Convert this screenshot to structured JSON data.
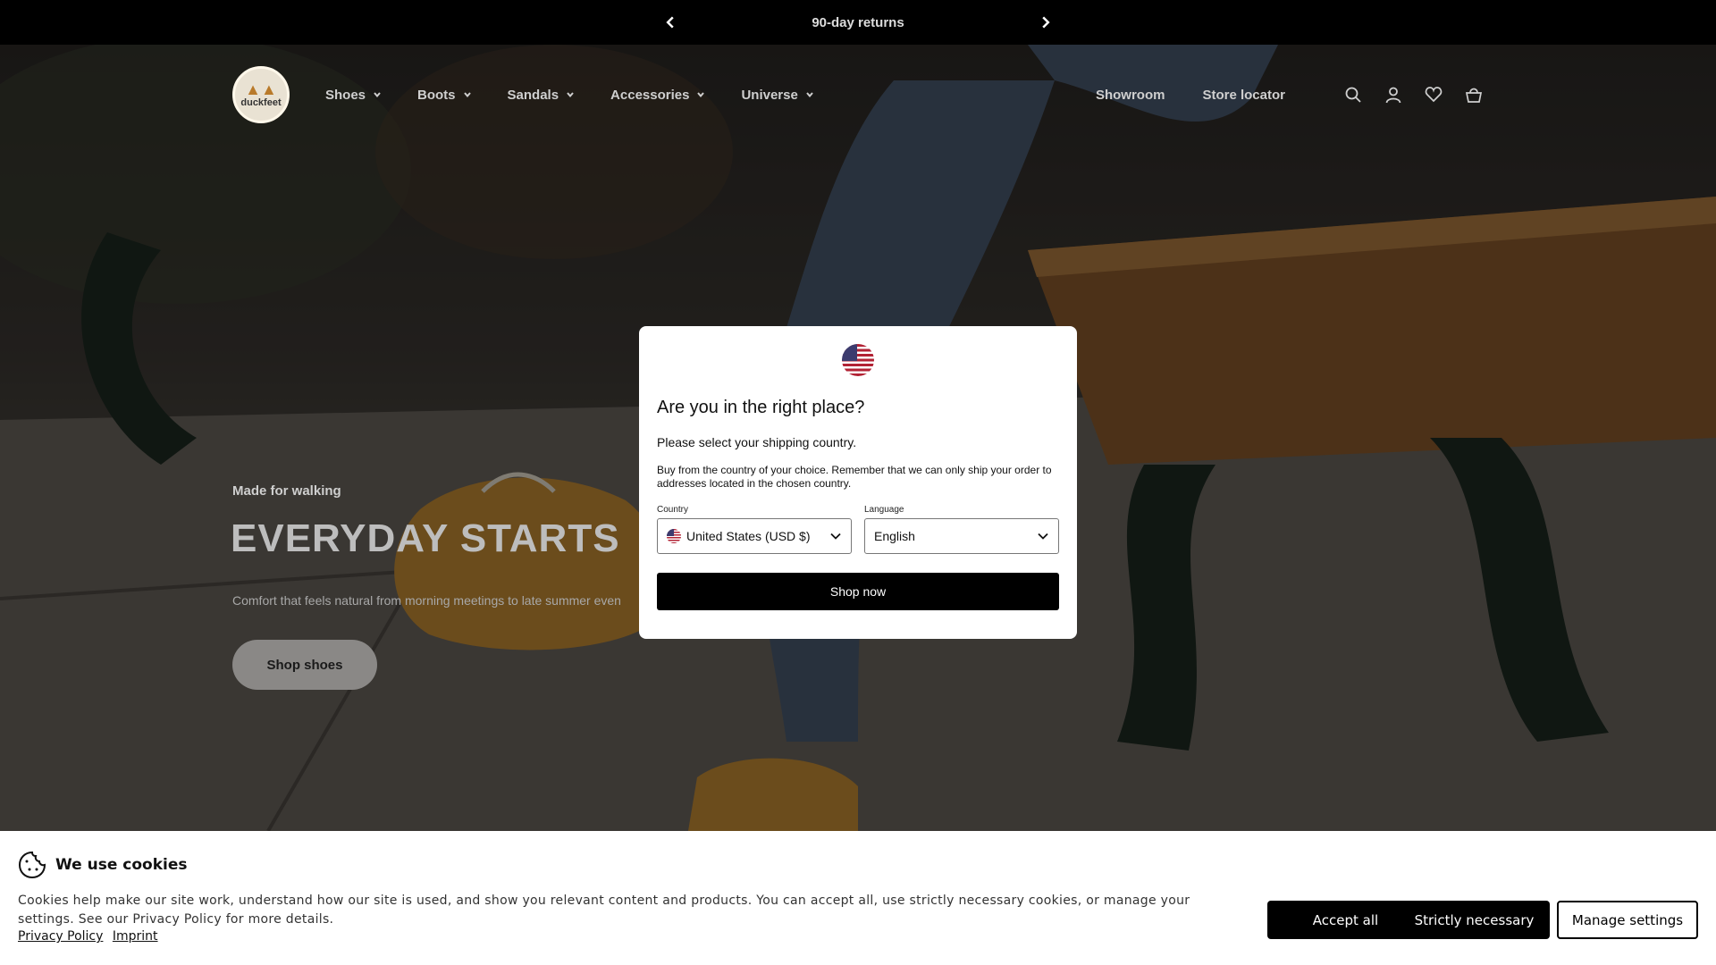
{
  "announcement": {
    "message": "90-day returns",
    "prev_icon": "chevron-left-icon",
    "next_icon": "chevron-right-icon"
  },
  "header": {
    "logo_text": "duckfeet",
    "nav": [
      {
        "label": "Shoes"
      },
      {
        "label": "Boots"
      },
      {
        "label": "Sandals"
      },
      {
        "label": "Accessories"
      },
      {
        "label": "Universe"
      }
    ],
    "links": [
      {
        "label": "Showroom"
      },
      {
        "label": "Store locator"
      }
    ],
    "icons": [
      "search-icon",
      "account-icon",
      "heart-icon",
      "basket-icon"
    ]
  },
  "hero": {
    "eyebrow": "Made for walking",
    "headline": "EVERYDAY STARTS",
    "subtext": "Comfort that feels natural from morning meetings to late summer even",
    "button": "Shop shoes"
  },
  "modal": {
    "title": "Are you in the right place?",
    "question": "Please select your shipping country.",
    "note": "Buy from the country of your choice. Remember that we can only ship your order to addresses located in the chosen country.",
    "country_label": "Country",
    "country_value": "United States (USD $)",
    "language_label": "Language",
    "language_value": "English",
    "button": "Shop now"
  },
  "cookies": {
    "title": "We use cookies",
    "body": "Cookies help make our site work, understand how our site is used, and show you relevant content and products. You can accept all, use strictly necessary cookies, or manage your settings. See our Privacy Policy for more details.",
    "privacy_link": "Privacy Policy",
    "imprint_link": "Imprint",
    "accept": "Accept all",
    "strict": "Strictly necessary",
    "manage": "Manage settings"
  },
  "colors": {
    "announcement_bg": "#000000",
    "primary_button": "#000000",
    "brand_accent": "#b97a2a"
  }
}
